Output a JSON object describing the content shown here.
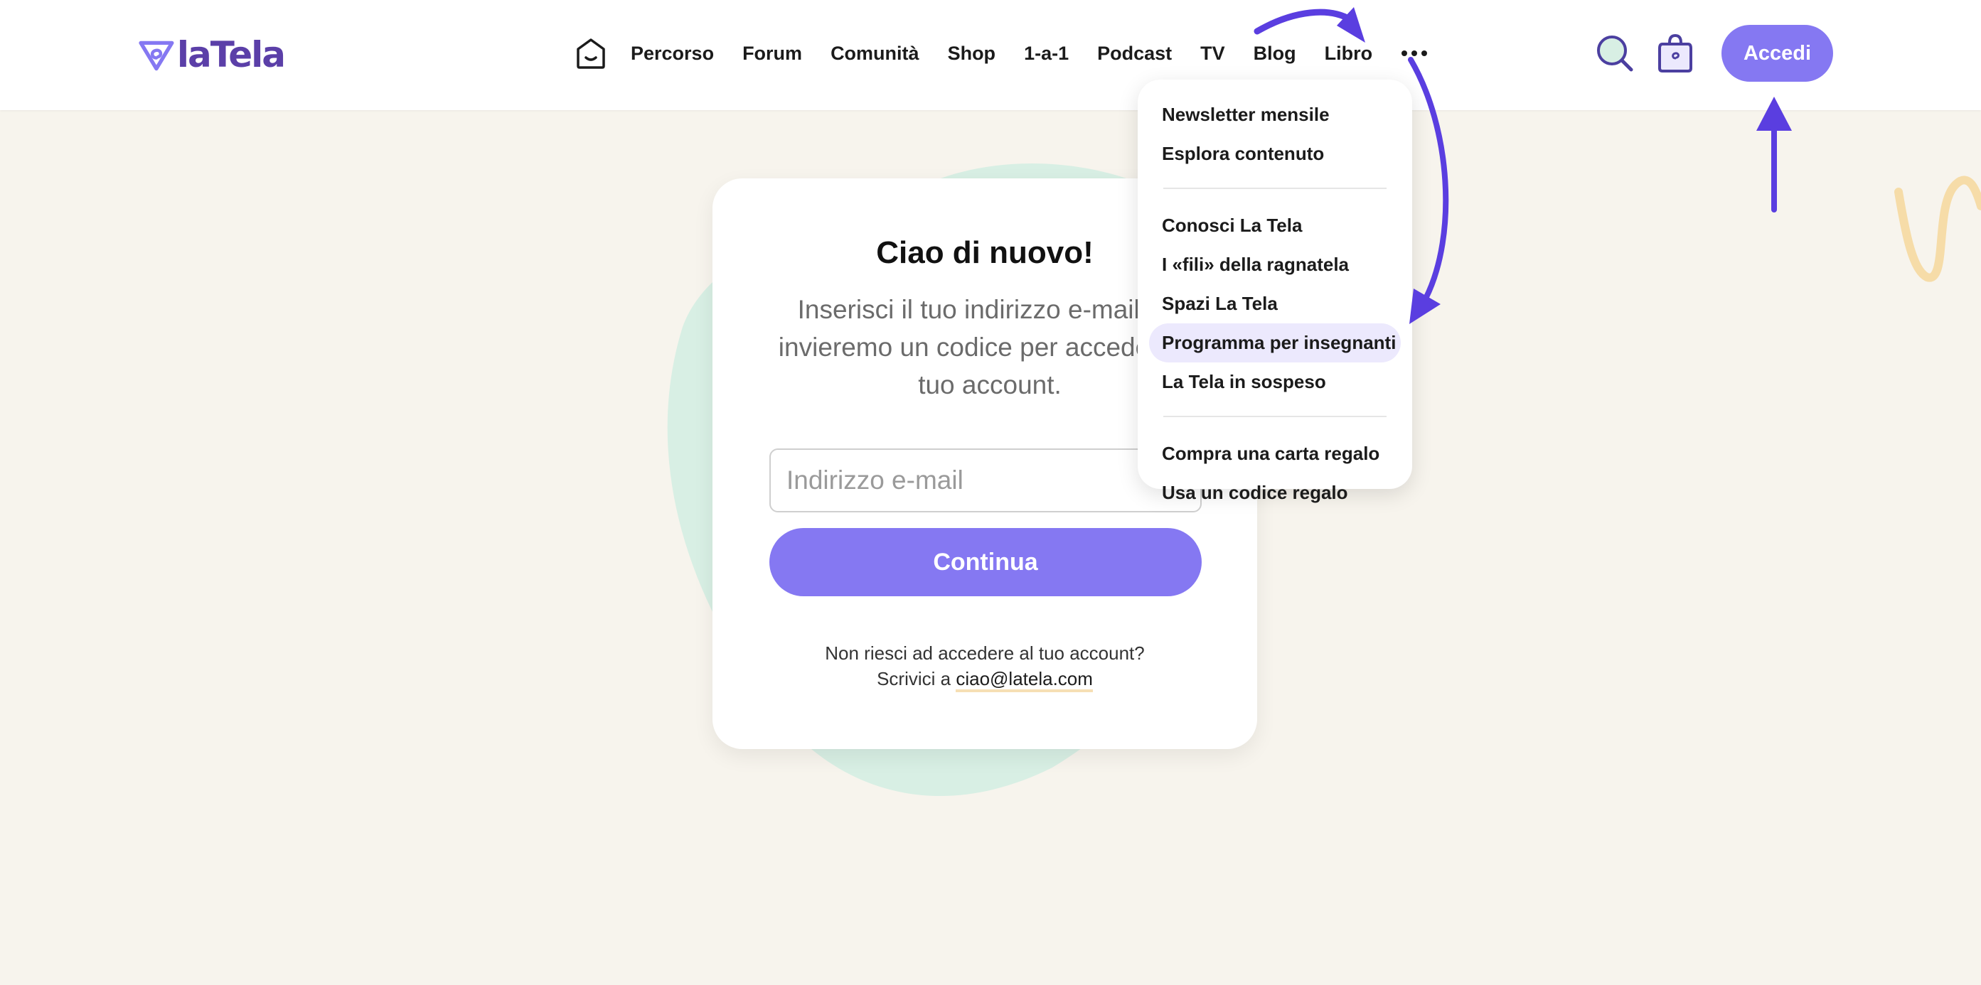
{
  "colors": {
    "accent": "#8578f2",
    "logo_purple": "#5b3fa8",
    "page_background": "#f7f4ed",
    "blob_green": "#d8efe4",
    "squiggle_yellow": "#f6dca8",
    "annotation_arrow": "#5a3ee0",
    "active_item_bg": "#ece9fd"
  },
  "header": {
    "logo_text": "laTela",
    "nav": {
      "items": [
        "Percorso",
        "Forum",
        "Comunità",
        "Shop",
        "1-a-1",
        "Podcast",
        "TV",
        "Blog",
        "Libro"
      ]
    },
    "icons": {
      "home": "home-face-icon",
      "more": "more-dots-icon",
      "search": "search-icon",
      "bag": "shopping-bag-icon"
    },
    "login_label": "Accedi"
  },
  "card": {
    "title": "Ciao di nuovo!",
    "subtitle": "Inserisci il tuo indirizzo e-mail e ti invieremo un codice per accedere al tuo account.",
    "email_placeholder": "Indirizzo e-mail",
    "continue_label": "Continua",
    "help_line1": "Non riesci ad accedere al tuo account?",
    "help_line2_prefix": "Scrivici a ",
    "help_email": "ciao@latela.com"
  },
  "dropdown": {
    "group1": [
      "Newsletter mensile",
      "Esplora contenuto"
    ],
    "group2": [
      "Conosci La Tela",
      "I «fili» della ragnatela",
      "Spazi La Tela",
      "Programma per insegnanti",
      "La Tela in sospeso"
    ],
    "group3": [
      "Compra una carta regalo",
      "Usa un codice regalo"
    ],
    "active_item": "Programma per insegnanti"
  }
}
